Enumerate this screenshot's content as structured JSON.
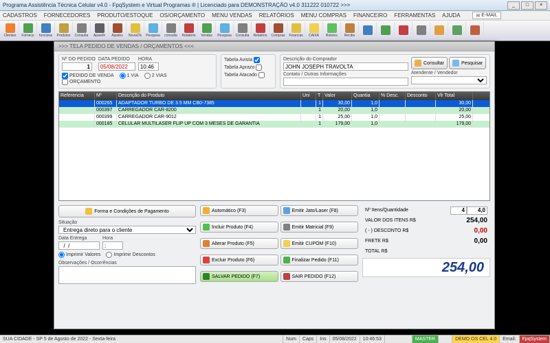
{
  "title": "Programa Assistência Técnica Celular v4.0 - FpqSystem e Virtual Programas ® | Licenciado para  DEMONSTRAÇÃO v4.0 311222 010722 >>>",
  "menu": [
    "CADASTROS",
    "FORNECEDORES",
    "PRODUTO/ESTOQUE",
    "OS/ORÇAMENTO",
    "MENU VENDAS",
    "RELATÓRIOS",
    "MENU COMPRAS",
    "FINANCEIRO",
    "FERRAMENTAS",
    "AJUDA"
  ],
  "email_btn": "E-MAIL",
  "toolbar": [
    "Clientes",
    "Fornece",
    "funciona",
    "Produtos",
    "Consulta",
    "Aparelh",
    "Ajustes",
    "NovaOS",
    "Pesquisa",
    "consulta",
    "Relatório",
    "Vendas",
    "Pesquisa",
    "Consulta",
    "Relatório",
    "Compras",
    "Financas",
    "CAIXA",
    "Boletos",
    "Recibo",
    "",
    "",
    "",
    "",
    "",
    "",
    ""
  ],
  "dialog_title": ">>>  TELA PEDIDO DE VENDAS / ORÇAMENTOS  <<<",
  "order": {
    "num_label": "Nº DO PEDIDO",
    "num": "1",
    "date_label": "DATA PEDIDO",
    "date": "05/08/2022",
    "time_label": "HORA",
    "time": "10:46",
    "chk_venda": "PEDIDO DE VENDA",
    "chk_orcamento": "ORÇAMENTO",
    "vias_1": "1 VIA",
    "vias_2": "2 VIAS",
    "tab_avista": "Tabela Avista",
    "tab_aprazo": "Tabela Aprazo",
    "tab_atacado": "Tabela Atacado"
  },
  "buyer": {
    "desc_label": "Descrição do Comprador",
    "name": "JOHN JOSEPH TRAVOLTA",
    "contact_label": "Contato / Outras Informações",
    "contact": "",
    "atendente_label": "Atendente / Vendedor",
    "atendente": "",
    "btn_consultar": "Consultar",
    "btn_pesquisar": "Pesquisar"
  },
  "grid": {
    "headers": [
      "Referencia",
      "Nº",
      "Descrição do Produto",
      "Uni",
      "T",
      "Valor",
      "Quantia",
      "% Desc.",
      "Desconto",
      "Vlr Total"
    ],
    "widths": [
      52,
      32,
      268,
      22,
      10,
      42,
      40,
      38,
      44,
      54
    ],
    "rows": [
      {
        "sel": true,
        "c": [
          "",
          "000265",
          "ADAPTADOR TURBO DE 3.5 MM CB0-7385",
          "",
          "1",
          "30,00",
          "1,0",
          "",
          "",
          "30,00"
        ]
      },
      {
        "sel": false,
        "c": [
          "",
          "000397",
          "CARREGADOR CAR-8200",
          "",
          "1",
          "20,00",
          "1,0",
          "",
          "",
          "20,00"
        ]
      },
      {
        "sel": false,
        "c": [
          "",
          "000399",
          "CARREGADOR CAR-9012",
          "",
          "1",
          "25,00",
          "1,0",
          "",
          "",
          "25,00"
        ]
      },
      {
        "sel": false,
        "c": [
          "",
          "000185",
          "CELULAR MULTILASER FLIP UP COM 3 MESES DE GARANTIA",
          "",
          "1",
          "179,00",
          "1,0",
          "",
          "",
          "179,00"
        ]
      }
    ]
  },
  "payment_btn": "Forma e Condições de Pagamento",
  "situacao_label": "Situação",
  "situacao": "Entrega direto para o cliente",
  "data_entrega_label": "Data Entrega",
  "data_entrega": "  /  /    ",
  "hora_label": "Hora",
  "hora_entrega": ":",
  "radio_imprimir_valores": "Imprimir Valores",
  "radio_imprimir_desc": "Imprimir Descontos",
  "obs_label": "Observações / Ocorrências",
  "actions": {
    "auto": "Automático  (F3)",
    "jato": "Emitir Jato/Laser (F8)",
    "incluir": "Incluir Produto  (F4)",
    "matricial": "Emitir Matricial  (F9)",
    "alterar": "Alterar Produto  (F5)",
    "cupom": "Emitir CUPOM  (F10)",
    "excluir": "Excluir Produto  (F6)",
    "finalizar": "Finalizar Pedido  (F11)",
    "salvar": "SALVAR PEDIDO (F7)",
    "sair": "SAIR  PEDIDO  (F12)"
  },
  "totals": {
    "itens_label": "Nº Itens/Quantidade",
    "itens": "4",
    "qtd": "4,0",
    "valor_label": "VALOR DOS ITENS R$",
    "valor": "254,00",
    "desc_label": "( - ) DESCONTO R$",
    "desc": "0,00",
    "frete_label": "FRETE      R$",
    "frete": "0,00",
    "total_label": "TOTAL R$",
    "total": "254,00"
  },
  "status": {
    "loc": "SUA CIDADE - SP  5 de Agosto de 2022 - Sexta-feira",
    "num": "Num",
    "caps": "Caps",
    "ins": "Ins",
    "date": "05/08/2022",
    "time": "10:46:53",
    "master": "MASTER",
    "demo": "DEMO OS CEL 4.0",
    "email": "Email:",
    "brand": "FpqSystem"
  }
}
